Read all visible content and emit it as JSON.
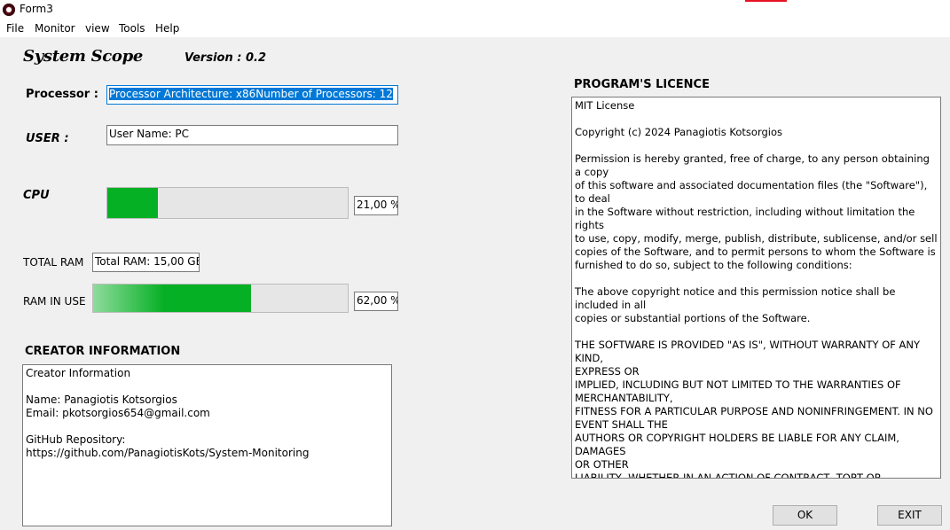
{
  "window": {
    "title": "Form3"
  },
  "menu": [
    "File",
    "Monitor",
    "view",
    "Tools",
    "Help"
  ],
  "app": {
    "name": "System Scope",
    "version": "Version : 0.2"
  },
  "processor": {
    "label": "Processor :",
    "value": "Processor Architecture: x86Number of Processors: 12"
  },
  "user": {
    "label": "USER :",
    "value": "User Name: PC"
  },
  "cpu": {
    "label": "CPU",
    "percent_text": "21,00 %",
    "percent": 21
  },
  "total_ram": {
    "label": "TOTAL RAM",
    "value": "Total RAM: 15,00 GB"
  },
  "ram_in_use": {
    "label": "RAM IN USE",
    "percent_text": "62,00 %",
    "percent": 62
  },
  "creator": {
    "heading": "CREATOR INFORMATION",
    "text": "Creator Information\n\nName: Panagiotis Kotsorgios\nEmail: pkotsorgios654@gmail.com\n\nGitHub Repository:\nhttps://github.com/PanagiotisKots/System-Monitoring"
  },
  "licence": {
    "heading": "PROGRAM'S LICENCE",
    "text": "MIT License\n\nCopyright (c) 2024 Panagiotis Kotsorgios\n\nPermission is hereby granted, free of charge, to any person obtaining a copy\nof this software and associated documentation files (the \"Software\"), to deal\nin the Software without restriction, including without limitation the rights\nto use, copy, modify, merge, publish, distribute, sublicense, and/or sell\ncopies of the Software, and to permit persons to whom the Software is\nfurnished to do so, subject to the following conditions:\n\nThe above copyright notice and this permission notice shall be included in all\ncopies or substantial portions of the Software.\n\nTHE SOFTWARE IS PROVIDED \"AS IS\", WITHOUT WARRANTY OF ANY KIND,\nEXPRESS OR\nIMPLIED, INCLUDING BUT NOT LIMITED TO THE WARRANTIES OF\nMERCHANTABILITY,\nFITNESS FOR A PARTICULAR PURPOSE AND NONINFRINGEMENT. IN NO\nEVENT SHALL THE\nAUTHORS OR COPYRIGHT HOLDERS BE LIABLE FOR ANY CLAIM, DAMAGES\nOR OTHER\nLIABILITY, WHETHER IN AN ACTION OF CONTRACT, TORT OR OTHERWISE,\nARISING FROM,\nOUT OF OR IN CONNECTION WITH THE SOFTWARE OR THE USE OR OTHER\nDEALINGS IN THE\nSOFTWARE."
  },
  "buttons": {
    "ok": "OK",
    "exit": "EXIT"
  },
  "colors": {
    "progress_fill": "#06b025",
    "selection": "#0078d7",
    "app_icon": "#7a1620"
  }
}
